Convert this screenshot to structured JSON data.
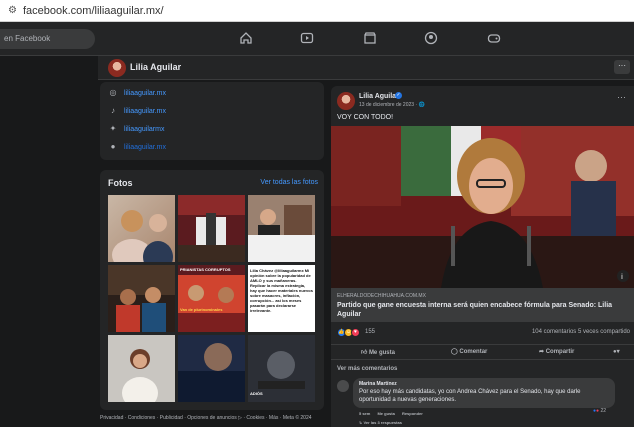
{
  "browser": {
    "url": "facebook.com/liliaaguilar.mx/"
  },
  "topnav": {
    "search_placeholder": "en Facebook"
  },
  "page": {
    "name": "Lilia Aguilar",
    "more_label": "···"
  },
  "links": [
    {
      "icon": "instagram-icon",
      "label": "liliaaguilar.mx"
    },
    {
      "icon": "tiktok-icon",
      "label": "liliaaguilar.mx"
    },
    {
      "icon": "twitter-icon",
      "label": "liliaaguilarmx"
    },
    {
      "icon": "web-icon",
      "label": "liliaaguilar.mx"
    }
  ],
  "photos": {
    "title": "Fotos",
    "see_all": "Ver todas las fotos",
    "captions": {
      "p6": "Lilia Chávez @liliaaguilarmx Mi opinión sobre la popularidad de AMLO y sus mañaneras. Replicar la misma estrategia, hay que hacer materiales nuevos sobre masacres, inflación, corrupción... así los meses pasarán para declararse irrelevante.",
      "p5": "PRIANISTAS CORRUPTOS",
      "p7": "ADIÓS",
      "p8": "Van de plurinominales"
    }
  },
  "footer": "Privacidad · Condiciones · Publicidad · Opciones de anuncios ▷ · Cookies · Más · Meta © 2024",
  "post": {
    "author": "Lilia Aguilar",
    "date": "13 de diciembre de 2023 · 🌐",
    "text": "VOY CON TODO!",
    "link_source": "ELHERALDODECHIHUAHUA.COM.MX",
    "link_title": "Partido que gane encuesta interna será quien encabece fórmula para Senado: Lilia Aguilar",
    "reaction_count": "155",
    "comments_shares": "104 comentarios  5 veces compartido",
    "like_label": "Me gusta",
    "comment_label": "Comentar",
    "share_label": "Compartir",
    "more_comments": "Ver más comentarios",
    "comment": {
      "name": "Marina Martínez",
      "text": "Por eso hay más candidatas, yo con Andrea Chávez para el Senado, hay que darle oportunidad a nuevas generaciones.",
      "time": "5 sem",
      "like": "Me gusta",
      "reply": "Responder",
      "reactions": "22",
      "replies": "↳ Ver las 3 respuestas"
    }
  },
  "colors": {
    "bg": "#18191a",
    "card": "#242526",
    "link": "#4599ff",
    "accent": "#2374e1"
  }
}
